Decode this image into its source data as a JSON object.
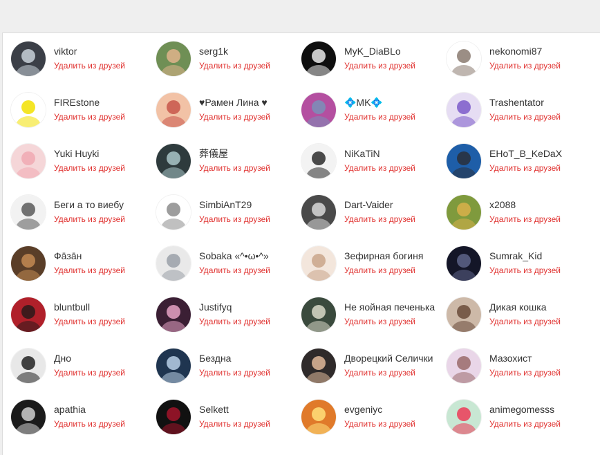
{
  "remove_label": "Удалить из друзей",
  "colors": {
    "accent": "#e0312f",
    "name": "#333333",
    "page_bg": "#efefef"
  },
  "friends": [
    {
      "name": "viktor",
      "bg": "#3b3f47",
      "fg": "#c9d1d9",
      "icon": "avatar-dark-collage"
    },
    {
      "name": "serg1k",
      "bg": "#6f8f55",
      "fg": "#e0b48c",
      "icon": "avatar-cartoon-face"
    },
    {
      "name": "MyK_DiaBLo",
      "bg": "#0f0f0f",
      "fg": "#e9e9e9",
      "icon": "avatar-white-mask"
    },
    {
      "name": "nekonomi87",
      "bg": "#ffffff",
      "fg": "#8a7a70",
      "icon": "avatar-cat"
    },
    {
      "name": "FIREstone",
      "bg": "#ffffff",
      "fg": "#f2e000",
      "icon": "avatar-smiley"
    },
    {
      "name": "♥Рамен Лина ♥",
      "bg": "#f2c2a6",
      "fg": "#c8564a",
      "icon": "avatar-redhead-girl"
    },
    {
      "name": "💠MK💠",
      "bg": "#b44fa0",
      "fg": "#7a8fb8",
      "icon": "avatar-purple-art"
    },
    {
      "name": "Trashentator",
      "bg": "#e6ddf3",
      "fg": "#7b5bc9",
      "icon": "avatar-neon-figure"
    },
    {
      "name": "Yuki Huyki",
      "bg": "#f5d6d8",
      "fg": "#f0a9b3",
      "icon": "avatar-kitten"
    },
    {
      "name": "葬儀屋",
      "bg": "#2e3b3d",
      "fg": "#a9c7c8",
      "icon": "avatar-skull"
    },
    {
      "name": "NiKaTiN",
      "bg": "#f3f3f3",
      "fg": "#2a2a2a",
      "icon": "avatar-anime-sketch"
    },
    {
      "name": "EHoT_B_KeDaX",
      "bg": "#1e5ea8",
      "fg": "#2a2f3a",
      "icon": "avatar-raccoon"
    },
    {
      "name": "Беги а то виебу",
      "bg": "#f2f2f2",
      "fg": "#5a5a5a",
      "icon": "avatar-manga-girl"
    },
    {
      "name": "SimbiAnT29",
      "bg": "#ffffff",
      "fg": "#8c8c8c",
      "icon": "avatar-cube"
    },
    {
      "name": "Dart-Vaider",
      "bg": "#4a4a4a",
      "fg": "#d8d8d8",
      "icon": "avatar-panda-suit"
    },
    {
      "name": "x2088",
      "bg": "#7f9a3d",
      "fg": "#d9b04a",
      "icon": "avatar-landscape"
    },
    {
      "name": "Фāзāн",
      "bg": "#5a3e28",
      "fg": "#c38a52",
      "icon": "avatar-warm-portrait"
    },
    {
      "name": "Sobaka «^•ω•^»",
      "bg": "#e9e9e9",
      "fg": "#9aa0a8",
      "icon": "avatar-silver-hair"
    },
    {
      "name": "Зефирная богиня",
      "bg": "#f3e6dc",
      "fg": "#c9a48a",
      "icon": "avatar-pastel-anime"
    },
    {
      "name": "Sumrak_Kid",
      "bg": "#141628",
      "fg": "#5d6488",
      "icon": "avatar-night"
    },
    {
      "name": "bluntbull",
      "bg": "#b0202a",
      "fg": "#2b1a1a",
      "icon": "avatar-red-character"
    },
    {
      "name": "Justifyq",
      "bg": "#3b1f34",
      "fg": "#e6a2c4",
      "icon": "avatar-sakura"
    },
    {
      "name": "Не яойная печенька",
      "bg": "#3a4a3d",
      "fg": "#d9d9c8",
      "icon": "avatar-green-girl"
    },
    {
      "name": "Дикая кошка",
      "bg": "#cdb9a8",
      "fg": "#6a4b3a",
      "icon": "avatar-room"
    },
    {
      "name": "Дно",
      "bg": "#e8e8e8",
      "fg": "#222222",
      "icon": "avatar-dark-hair-girl"
    },
    {
      "name": "Бездна",
      "bg": "#1f3550",
      "fg": "#b9cfe6",
      "icon": "avatar-blue-anime"
    },
    {
      "name": "Дворецкий Селички",
      "bg": "#2f2a2a",
      "fg": "#e0b99a",
      "icon": "avatar-man-glasses"
    },
    {
      "name": "Мазохист",
      "bg": "#e9d6e8",
      "fg": "#9a6b6b",
      "icon": "avatar-boy-portrait"
    },
    {
      "name": "apathia",
      "bg": "#1b1b1b",
      "fg": "#cfcfcf",
      "icon": "avatar-bw-photo"
    },
    {
      "name": "Selkett",
      "bg": "#111111",
      "fg": "#a3142a",
      "icon": "avatar-gothic-girl"
    },
    {
      "name": "evgeniyс",
      "bg": "#e07a2a",
      "fg": "#ffe07a",
      "icon": "avatar-sunburst"
    },
    {
      "name": "animegomesss",
      "bg": "#c8e7d3",
      "fg": "#ec3b57",
      "icon": "avatar-green-bg-girl"
    }
  ]
}
